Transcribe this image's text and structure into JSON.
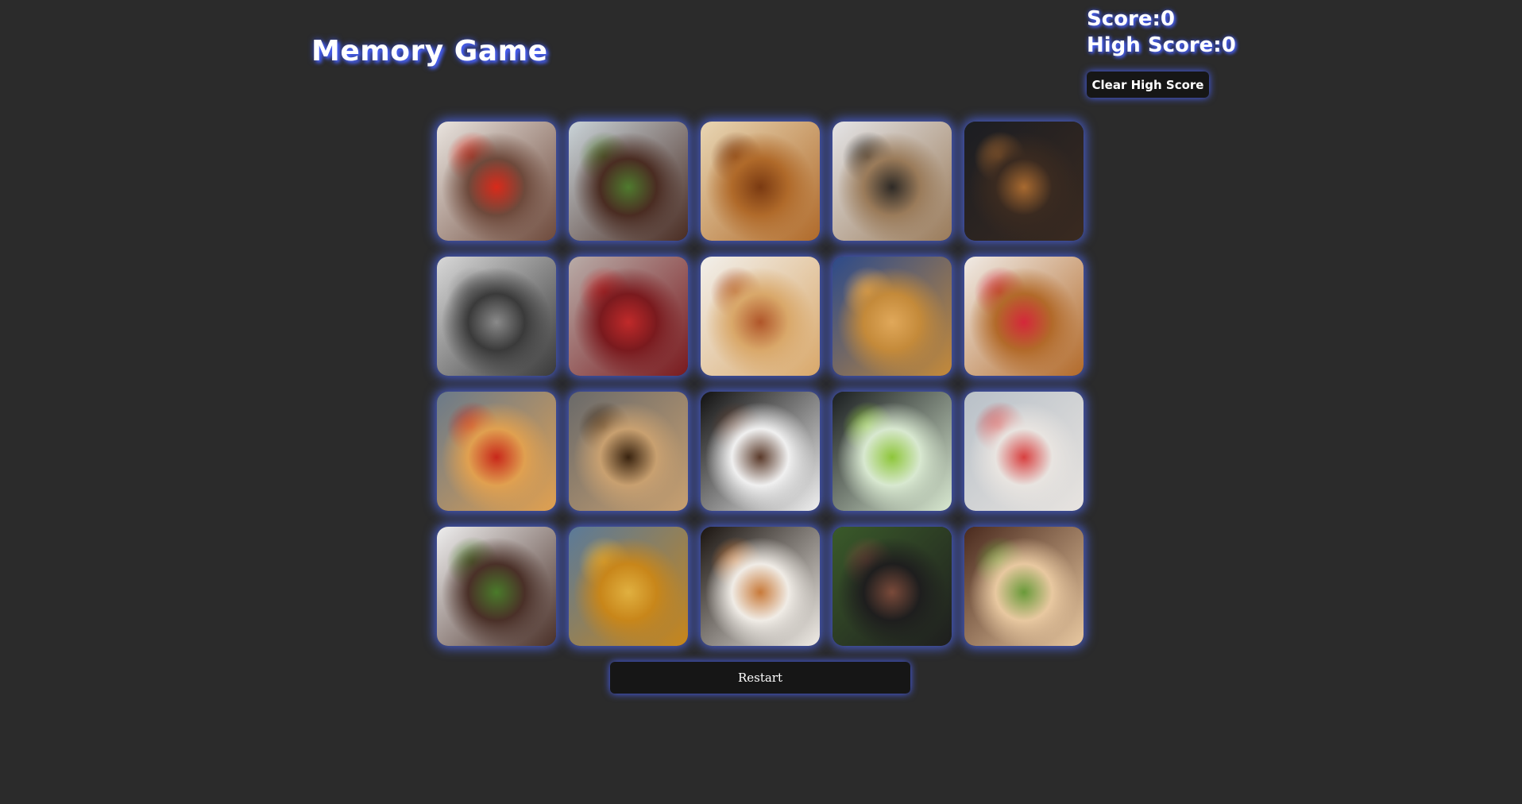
{
  "game": {
    "title": "Memory Game"
  },
  "score": {
    "score_label": "Score:",
    "score_value": "0",
    "high_score_label": "High Score:",
    "high_score_value": "0",
    "clear_button_label": "Clear High Score"
  },
  "controls": {
    "restart_label": "Restart"
  },
  "colors": {
    "background": "#2b2b2b",
    "glow": "#4a63ff",
    "button_bg": "#161616",
    "text": "#ffffff"
  },
  "cards": [
    {
      "name": "lamb-chops-tomatoes-image",
      "bg1": "#e9e4df",
      "bg2": "#6e4a3c",
      "accent": "#d92a1a"
    },
    {
      "name": "steak-asparagus-image",
      "bg1": "#c9d3d8",
      "bg2": "#4a2c22",
      "accent": "#4f7a2e"
    },
    {
      "name": "nachos-image",
      "bg1": "#e8d6b4",
      "bg2": "#b06a2a",
      "accent": "#7a3a12"
    },
    {
      "name": "sandwich-image",
      "bg1": "#e4e4e6",
      "bg2": "#9a7b5a",
      "accent": "#2e2a26"
    },
    {
      "name": "dark-croissant-image",
      "bg1": "#1b1d22",
      "bg2": "#3a2a20",
      "accent": "#a86a30"
    },
    {
      "name": "chef-cooking-image",
      "bg1": "#d8d8d8",
      "bg2": "#3a3a3a",
      "accent": "#8a8a8a"
    },
    {
      "name": "cranberries-image",
      "bg1": "#b8aca8",
      "bg2": "#7a1a1e",
      "accent": "#c02a2a"
    },
    {
      "name": "spaghetti-image",
      "bg1": "#f2f0ec",
      "bg2": "#d9a86a",
      "accent": "#b0562a"
    },
    {
      "name": "fried-chicken-image",
      "bg1": "#2c4a8a",
      "bg2": "#c48a3a",
      "accent": "#e0a85a"
    },
    {
      "name": "french-toast-image",
      "bg1": "#f0ebe6",
      "bg2": "#b26a2a",
      "accent": "#d4283a"
    },
    {
      "name": "pizza-image",
      "bg1": "#6a7a8a",
      "bg2": "#e0a050",
      "accent": "#c8281a"
    },
    {
      "name": "cookies-image",
      "bg1": "#6a6a6a",
      "bg2": "#c8a070",
      "accent": "#3a2410"
    },
    {
      "name": "lamb-plate-image",
      "bg1": "#111111",
      "bg2": "#f0f0f0",
      "accent": "#5a3a2a"
    },
    {
      "name": "mojito-image",
      "bg1": "#1a1e20",
      "bg2": "#d8e8d0",
      "accent": "#8ec63a"
    },
    {
      "name": "popsicle-image",
      "bg1": "#b8c0c8",
      "bg2": "#e8e4e0",
      "accent": "#d84040"
    },
    {
      "name": "lamb-asparagus-bowl-image",
      "bg1": "#eeeeee",
      "bg2": "#4a3028",
      "accent": "#4a7a2a"
    },
    {
      "name": "curry-image",
      "bg1": "#5a7a9a",
      "bg2": "#c8861a",
      "accent": "#e0b040"
    },
    {
      "name": "fine-dining-fish-image",
      "bg1": "#1a1410",
      "bg2": "#f0ece6",
      "accent": "#c87a3a"
    },
    {
      "name": "lamb-skillet-image",
      "bg1": "#3a5a2a",
      "bg2": "#1e1e1e",
      "accent": "#7a4a3a"
    },
    {
      "name": "breaded-cutlet-image",
      "bg1": "#4a2a1e",
      "bg2": "#e8c8a0",
      "accent": "#6a9a3a"
    }
  ]
}
